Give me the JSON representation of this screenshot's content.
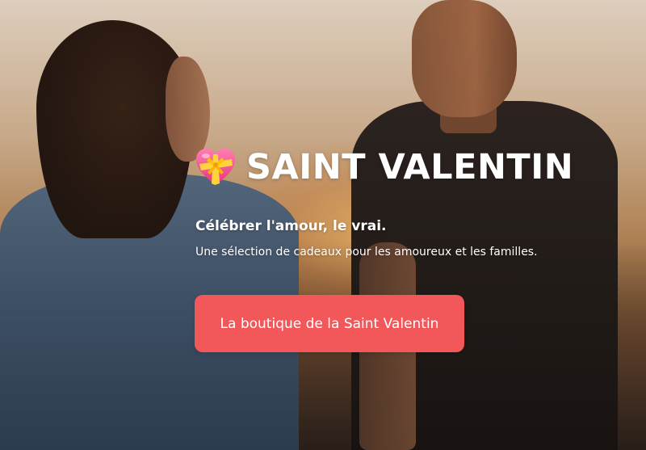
{
  "hero": {
    "title": "SAINT VALENTIN",
    "title_icon": "heart-with-ribbon-icon",
    "tagline": "Célébrer l'amour, le vrai.",
    "subtitle": "Une sélection de cadeaux pour les amoureux et les familles.",
    "cta_label": "La boutique de la Saint Valentin"
  },
  "colors": {
    "cta_background": "#f2575a",
    "text": "#ffffff"
  }
}
